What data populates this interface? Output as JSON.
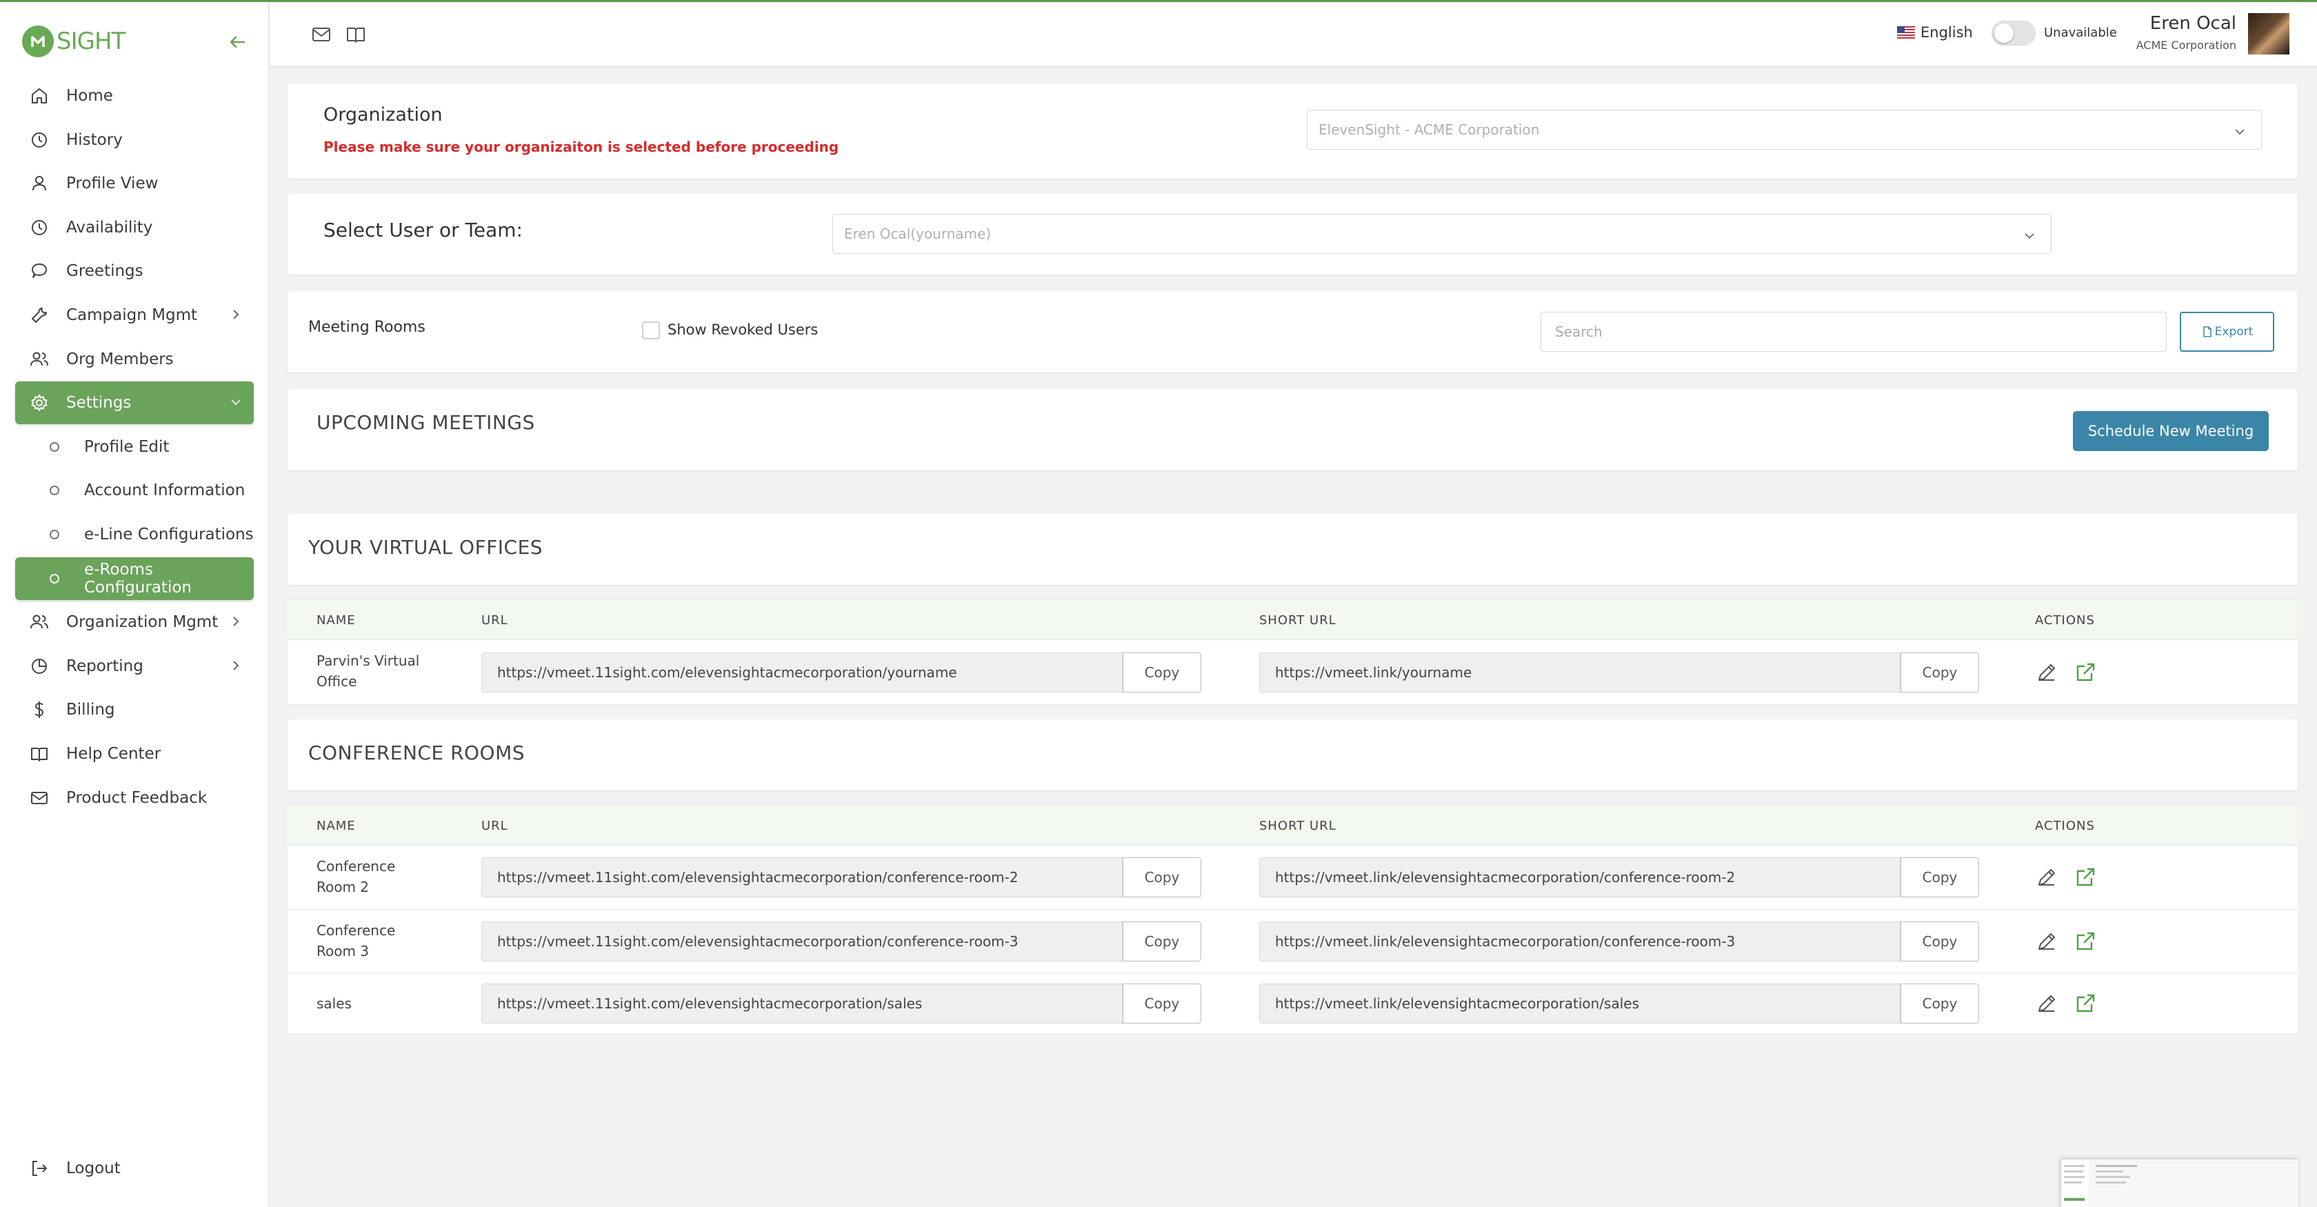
{
  "brand": {
    "logo_text": "SIGHT",
    "accent": "#6aa35a",
    "primary": "#3b86a8",
    "warning": "#d62b2b"
  },
  "sidebar": {
    "items": [
      {
        "label": "Home",
        "icon": "home-icon"
      },
      {
        "label": "History",
        "icon": "clock-icon"
      },
      {
        "label": "Profile View",
        "icon": "user-icon"
      },
      {
        "label": "Availability",
        "icon": "clock-icon"
      },
      {
        "label": "Greetings",
        "icon": "chat-bubble-icon"
      },
      {
        "label": "Campaign Mgmt",
        "icon": "wrench-icon"
      },
      {
        "label": "Org Members",
        "icon": "users-icon"
      },
      {
        "label": "Settings",
        "icon": "gear-icon"
      },
      {
        "label": "Profile Edit"
      },
      {
        "label": "Account Information"
      },
      {
        "label": "e-Line Configurations"
      },
      {
        "label": "e-Rooms Configuration"
      },
      {
        "label": "Organization Mgmt",
        "icon": "users-icon"
      },
      {
        "label": "Reporting",
        "icon": "pie-chart-icon"
      },
      {
        "label": "Billing",
        "icon": "dollar-icon"
      },
      {
        "label": "Help Center",
        "icon": "book-icon"
      },
      {
        "label": "Product Feedback",
        "icon": "mail-icon"
      }
    ],
    "logout": "Logout"
  },
  "topbar": {
    "language": "English",
    "status": "Unavailable",
    "user_name": "Eren Ocal",
    "user_org": "ACME Corporation"
  },
  "organization": {
    "title": "Organization",
    "warning": "Please make sure your organizaiton is selected before proceeding",
    "selected": "ElevenSight - ACME Corporation"
  },
  "select_user": {
    "label": "Select User or Team:",
    "selected": "Eren Ocal(yourname)"
  },
  "meeting_rooms": {
    "label": "Meeting Rooms",
    "show_revoked": "Show Revoked Users",
    "search_placeholder": "Search",
    "export": "Export"
  },
  "upcoming": {
    "title": "UPCOMING MEETINGS",
    "schedule_button": "Schedule New Meeting"
  },
  "table_headers": {
    "name": "NAME",
    "url": "URL",
    "short_url": "SHORT URL",
    "actions": "ACTIONS"
  },
  "copy_label": "Copy",
  "virtual_offices": {
    "title": "YOUR VIRTUAL OFFICES",
    "rows": [
      {
        "name_1": "Parvin's Virtual",
        "name_2": "Office",
        "url": "https://vmeet.11sight.com/elevensightacmecorporation/yourname",
        "short_url": "https://vmeet.link/yourname"
      }
    ]
  },
  "conference_rooms": {
    "title": "CONFERENCE ROOMS",
    "rows": [
      {
        "name_1": "Conference",
        "name_2": "Room 2",
        "url": "https://vmeet.11sight.com/elevensightacmecorporation/conference-room-2",
        "short_url": "https://vmeet.link/elevensightacmecorporation/conference-room-2"
      },
      {
        "name_1": "Conference",
        "name_2": "Room 3",
        "url": "https://vmeet.11sight.com/elevensightacmecorporation/conference-room-3",
        "short_url": "https://vmeet.link/elevensightacmecorporation/conference-room-3"
      },
      {
        "name_1": "sales",
        "name_2": "",
        "url": "https://vmeet.11sight.com/elevensightacmecorporation/sales",
        "short_url": "https://vmeet.link/elevensightacmecorporation/sales"
      }
    ]
  }
}
